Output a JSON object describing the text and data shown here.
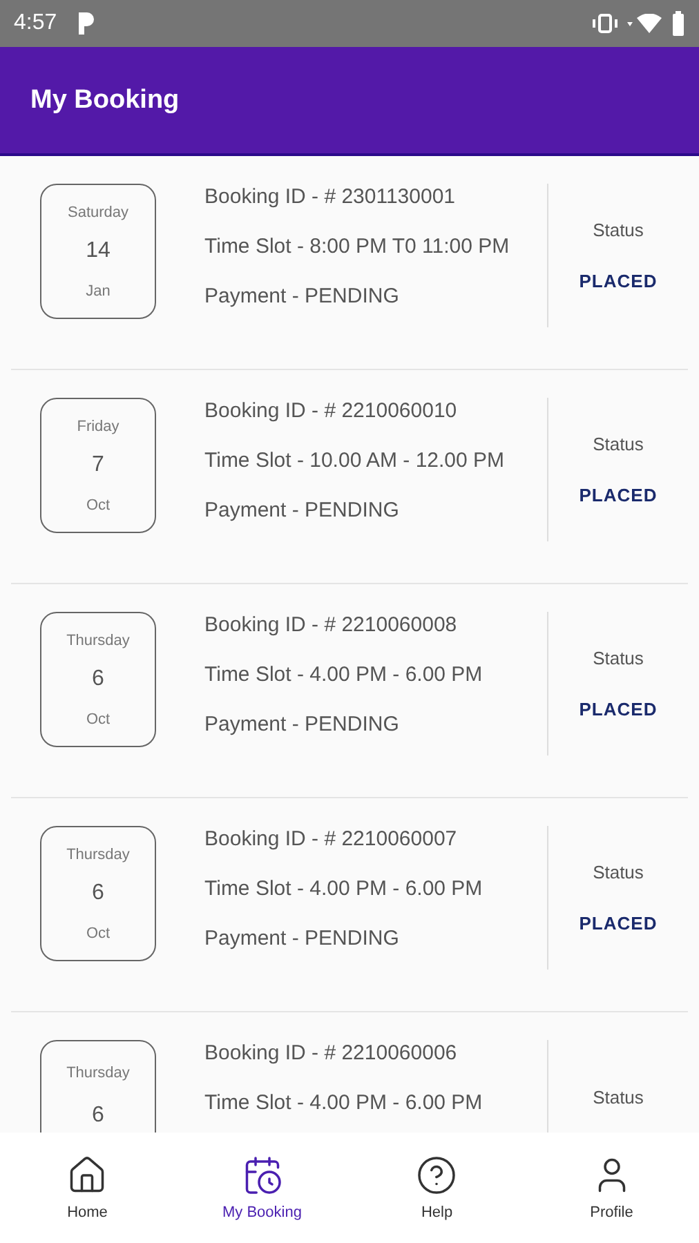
{
  "status_bar": {
    "time": "4:57"
  },
  "app_bar": {
    "title": "My Booking"
  },
  "bookings": [
    {
      "day": "Saturday",
      "date": "14",
      "month": "Jan",
      "booking_id": "Booking ID - # 2301130001",
      "time_slot": "Time Slot - 8:00 PM T0 11:00 PM",
      "payment": "Payment - PENDING",
      "status_label": "Status",
      "status": "PLACED"
    },
    {
      "day": "Friday",
      "date": "7",
      "month": "Oct",
      "booking_id": "Booking ID - # 2210060010",
      "time_slot": "Time Slot - 10.00 AM - 12.00 PM",
      "payment": "Payment - PENDING",
      "status_label": "Status",
      "status": "PLACED"
    },
    {
      "day": "Thursday",
      "date": "6",
      "month": "Oct",
      "booking_id": "Booking ID - # 2210060008",
      "time_slot": "Time Slot - 4.00 PM - 6.00 PM",
      "payment": "Payment - PENDING",
      "status_label": "Status",
      "status": "PLACED"
    },
    {
      "day": "Thursday",
      "date": "6",
      "month": "Oct",
      "booking_id": "Booking ID - # 2210060007",
      "time_slot": "Time Slot - 4.00 PM - 6.00 PM",
      "payment": "Payment - PENDING",
      "status_label": "Status",
      "status": "PLACED"
    },
    {
      "day": "Thursday",
      "date": "6",
      "booking_id": "Booking ID - # 2210060006",
      "time_slot": "Time Slot - 4.00 PM - 6.00 PM",
      "status_label": "Status"
    }
  ],
  "nav": [
    {
      "label": "Home",
      "selected": false
    },
    {
      "label": "My Booking",
      "selected": true
    },
    {
      "label": "Help",
      "selected": false
    },
    {
      "label": "Profile",
      "selected": false
    }
  ]
}
